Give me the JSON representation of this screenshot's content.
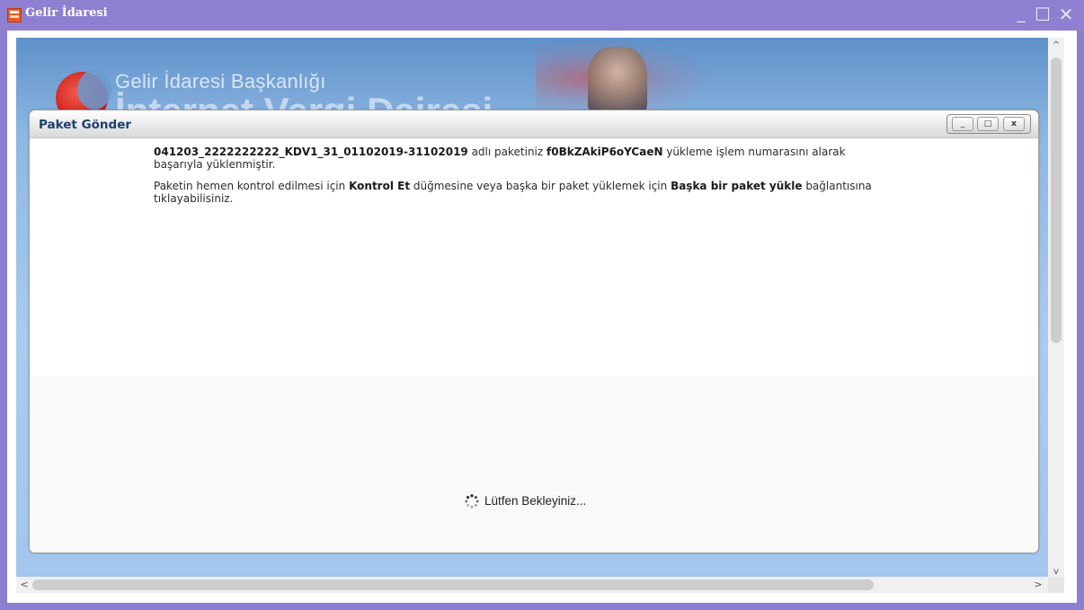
{
  "window": {
    "title": "Gelir İdaresi",
    "controls": {
      "minimize": "_",
      "maximize": "☐",
      "close": "✕"
    }
  },
  "banner": {
    "org_name": "Gelir İdaresi Başkanlığı",
    "subtitle_partial": "İnternet Vergi Dairesi"
  },
  "dialog": {
    "title": "Paket Gönder",
    "controls": {
      "minimize": "_",
      "maximize": "□",
      "close": "x"
    },
    "message1": {
      "package_name": "041203_2222222222_KDV1_31_01102019-31102019",
      "text_a": " adlı paketiniz ",
      "upload_id": "f0BkZAkiP6oYCaeN",
      "text_b": " yükleme işlem numarasını alarak başarıyla yüklenmiştir."
    },
    "message2": {
      "text_a": "Paketin hemen kontrol edilmesi için ",
      "link_check": "Kontrol Et",
      "text_b": " düğmesine veya başka bir paket yüklemek için ",
      "link_upload": "Başka bir paket yükle",
      "text_c": " bağlantısına tıklayabilisiniz."
    },
    "loading_text": "Lütfen Bekleyiniz..."
  },
  "side_glyph": "I!",
  "scrollbars": {
    "up": "^",
    "down": "v",
    "left": "<",
    "right": ">"
  },
  "icons": {
    "app": "gelir-idaresi-app-icon",
    "spinner": "loading-spinner-icon"
  },
  "colors": {
    "titlebar": "#8e7fd1",
    "dialog_title": "#1b3f73",
    "banner_blue": "#8eb7e3"
  }
}
